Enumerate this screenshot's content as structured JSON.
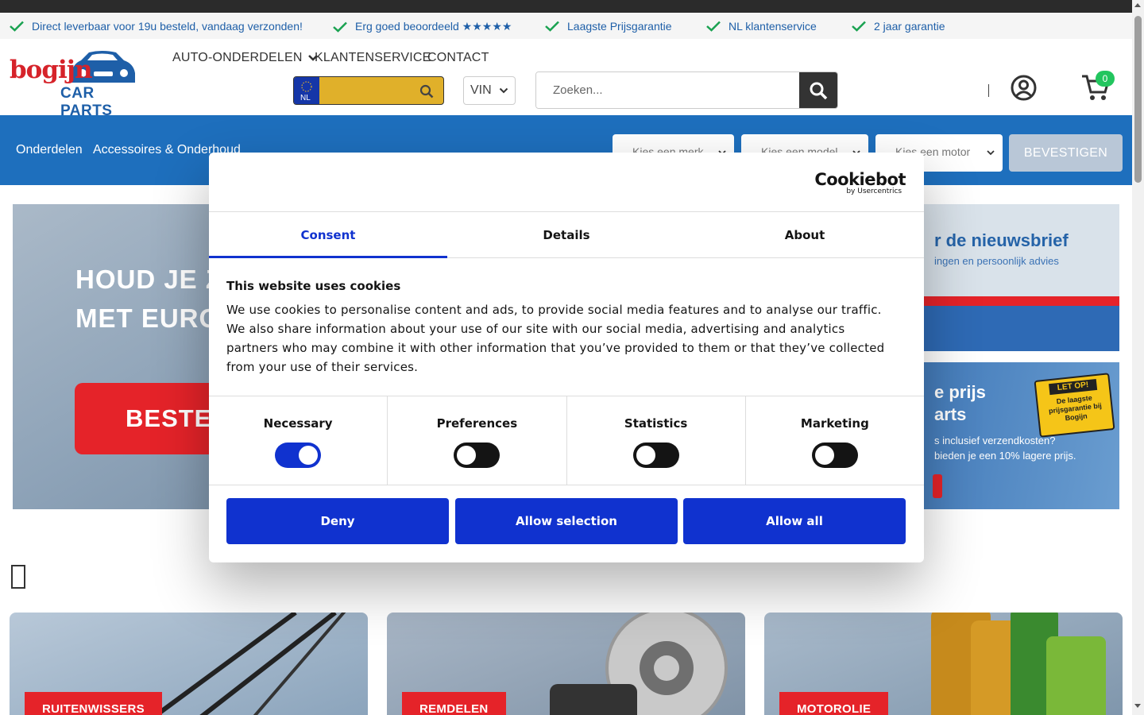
{
  "usp": [
    "Direct leverbaar voor 19u besteld, vandaag verzonden!",
    "Erg goed beoordeeld ★★★★★",
    "Laagste Prijsgarantie",
    "NL klantenservice",
    "2 jaar garantie"
  ],
  "logo": {
    "line1": "bogijn",
    "line2": "CAR PARTS"
  },
  "nav": {
    "parts": "AUTO-ONDERDELEN",
    "service": "KLANTENSERVICE",
    "contact": "CONTACT"
  },
  "plate": {
    "country": "NL"
  },
  "vin": {
    "label": "VIN"
  },
  "search": {
    "placeholder": "Zoeken..."
  },
  "cart": {
    "count": "0"
  },
  "bluebar": {
    "link1": "Onderdelen",
    "link2": "Accessoires & Onderhoud",
    "brand": "Kies een merk",
    "model": "Kies een model",
    "engine": "Kies een motor",
    "confirm": "BEVESTIGEN"
  },
  "hero": {
    "line1": "HOUD JE Z",
    "line2": "MET EURO",
    "button": "BESTEL"
  },
  "promo1": {
    "title": "r de nieuwsbrief",
    "sub": "ingen en persoonlijk advies"
  },
  "promo2": {
    "title1": "e prijs",
    "title2": "arts",
    "sub1": "s inclusief verzendkosten?",
    "sub2": "bieden je een 10% lagere prijs.",
    "badge_head": "LET OP!",
    "badge_body": "De laagste prijsgarantie bij Bogijn"
  },
  "cards": [
    "RUITENWISSERS",
    "REMDELEN",
    "MOTOROLIE"
  ],
  "cookie": {
    "logo_main": "Cookiebot",
    "logo_sub": "by Usercentrics",
    "tabs": [
      "Consent",
      "Details",
      "About"
    ],
    "title": "This website uses cookies",
    "text": "We use cookies to personalise content and ads, to provide social media features and to analyse our traffic. We also share information about your use of our site with our social media, advertising and analytics partners who may combine it with other information that you’ve provided to them or that they’ve collected from your use of their services.",
    "toggles": [
      {
        "label": "Necessary",
        "on": true
      },
      {
        "label": "Preferences",
        "on": false
      },
      {
        "label": "Statistics",
        "on": false
      },
      {
        "label": "Marketing",
        "on": false
      }
    ],
    "buttons": {
      "deny": "Deny",
      "selection": "Allow selection",
      "all": "Allow all"
    }
  },
  "colors": {
    "primary_blue": "#1e6fbd",
    "cookie_blue": "#1032cf",
    "red": "#e52329",
    "check_green": "#1aa251",
    "cart_badge": "#22c55e"
  },
  "icons": [
    "check-icon",
    "chevron-down-icon",
    "search-icon",
    "account-icon",
    "cart-icon",
    "eu-stars-icon"
  ]
}
